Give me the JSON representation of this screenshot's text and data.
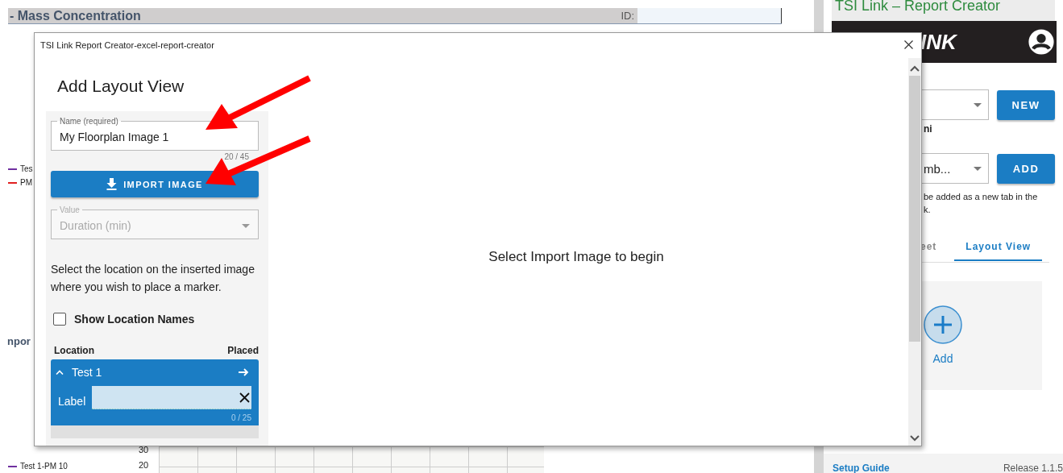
{
  "background_sheet": {
    "title": "- Mass Concentration",
    "id_label": "ID:",
    "legend": [
      {
        "label": "Tes",
        "color": "#7030a0"
      },
      {
        "label": "PM",
        "color": "#e02020"
      }
    ],
    "section_heading": "npor",
    "axis_ticks": [
      "30",
      "20"
    ],
    "legend_bottom": {
      "label": "Test 1-PM 10",
      "color": "#7030a0"
    }
  },
  "side_panel": {
    "title": "TSI Link – Report Creator",
    "logo_text": "INK",
    "new_button": "NEW",
    "caption": "ni",
    "dropdown_value": "mb...",
    "add_button": "ADD",
    "hint_lines": [
      "be added as a new tab in the",
      "k."
    ],
    "tabs": [
      {
        "label": "eet",
        "selected": false
      },
      {
        "label": "Layout View",
        "selected": true
      }
    ],
    "add_label": "Add",
    "footer_link": "Setup Guide",
    "release": "Release 1.1.5"
  },
  "dialog": {
    "title": "TSI Link Report Creator-excel-report-creator",
    "heading": "Add Layout View",
    "name_field": {
      "label": "Name (required)",
      "value": "My Floorplan Image 1",
      "counter": "20 / 45"
    },
    "import_button": "IMPORT IMAGE",
    "value_field": {
      "label": "Value",
      "value": "Duration (min)",
      "disabled": true
    },
    "instructions": "Select the location on the inserted image where you wish to place a marker.",
    "show_names": {
      "label": "Show Location Names",
      "checked": false
    },
    "location_header": "Location",
    "placed_header": "Placed",
    "locations": [
      {
        "name": "Test 1",
        "expanded": true,
        "selected": true,
        "label_field": {
          "label": "Label",
          "counter": "0 / 25"
        }
      }
    ],
    "empty_message": "Select Import Image to begin"
  }
}
